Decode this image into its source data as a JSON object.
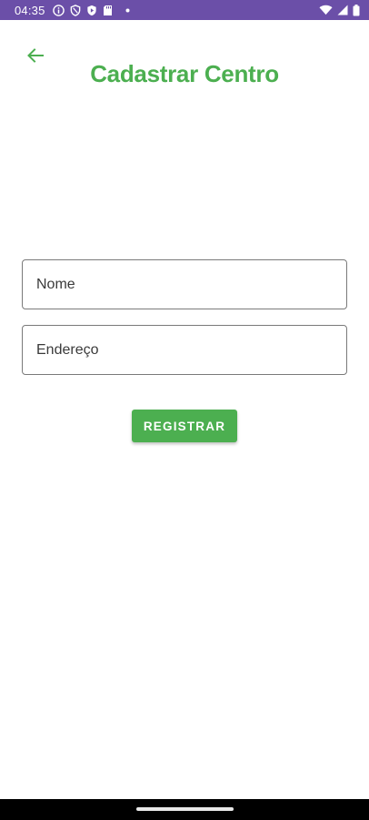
{
  "status_bar": {
    "time": "04:35",
    "background_color": "#6b4fa8",
    "left_icons": [
      "info-icon",
      "shield-icon",
      "play-protect-icon",
      "sd-card-icon",
      "dot-icon"
    ],
    "right_icons": [
      "wifi-icon",
      "signal-icon",
      "battery-icon"
    ]
  },
  "header": {
    "back_icon": "arrow-back-icon",
    "title": "Cadastrar Centro",
    "accent_color": "#4caf50"
  },
  "form": {
    "name_field": {
      "placeholder": "Nome",
      "value": ""
    },
    "address_field": {
      "placeholder": "Endereço",
      "value": ""
    },
    "submit_label": "REGISTRAR"
  }
}
